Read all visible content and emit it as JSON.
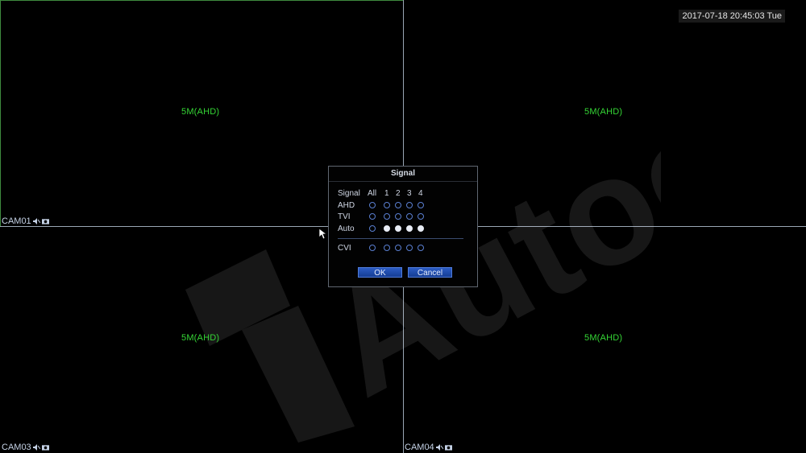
{
  "screen": {
    "datetime": "2017-07-18 20:45:03 Tue",
    "watermark_text": "Autoeye"
  },
  "channels": [
    {
      "name": "CAM01",
      "resolution": "5M(AHD)"
    },
    {
      "name": "",
      "resolution": "5M(AHD)"
    },
    {
      "name": "CAM03",
      "resolution": "5M(AHD)"
    },
    {
      "name": "CAM04",
      "resolution": "5M(AHD)"
    }
  ],
  "dialog": {
    "title": "Signal",
    "headers": [
      "Signal",
      "All",
      "1",
      "2",
      "3",
      "4"
    ],
    "rows": [
      {
        "label": "AHD",
        "selected": [
          false,
          false,
          false,
          false,
          false
        ]
      },
      {
        "label": "TVI",
        "selected": [
          false,
          false,
          false,
          false,
          false
        ]
      },
      {
        "label": "Auto",
        "selected": [
          false,
          true,
          true,
          true,
          true
        ]
      },
      {
        "label": "CVI",
        "selected": [
          false,
          false,
          false,
          false,
          false
        ]
      }
    ],
    "ok_label": "OK",
    "cancel_label": "Cancel"
  },
  "colors": {
    "background": "#000000",
    "grid": "#9aa6b4",
    "resolution_text": "#35d635",
    "button": "#1f4cae",
    "radio_border": "#5a7fd1"
  }
}
